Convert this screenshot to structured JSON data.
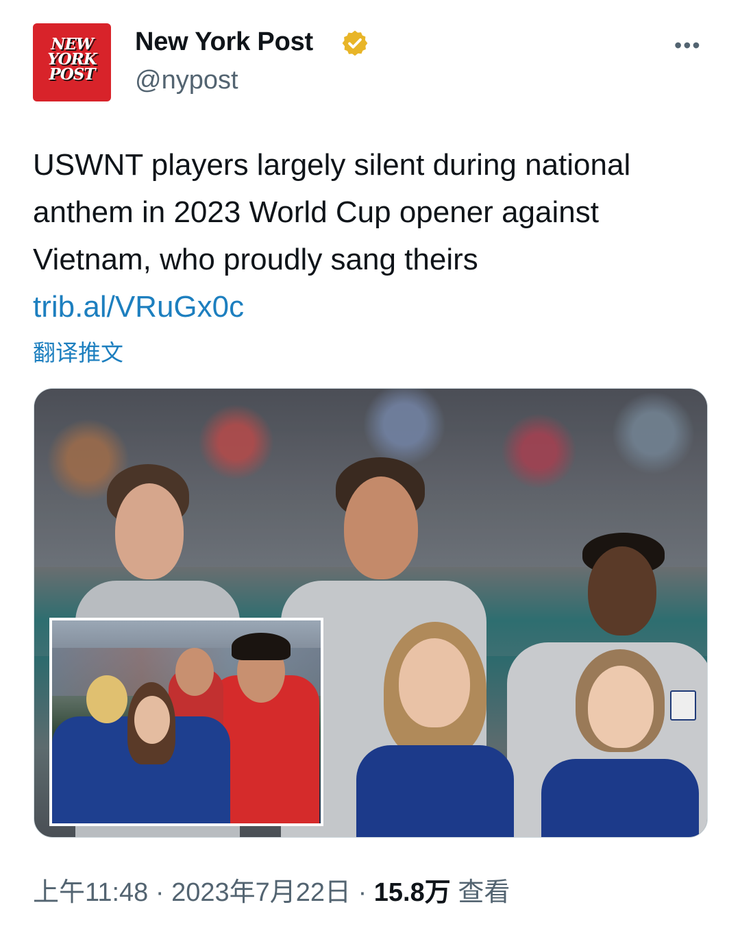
{
  "author": {
    "logo_text": "NEW YORK POST",
    "display_name": "New York Post",
    "handle": "@nypost",
    "verified": true,
    "avatar_color": "#d8232a"
  },
  "menu_icon": "more-horizontal-icon",
  "tweet": {
    "text": "USWNT players largely silent during national anthem in 2023 World Cup opener against Vietnam, who proudly sang theirs",
    "link": "trib.al/VRuGx0c",
    "translate_label": "翻译推文"
  },
  "photo": {
    "inset_present": true
  },
  "meta": {
    "time": "上午11:48",
    "separator": "·",
    "date": "2023年7月22日",
    "views_count": "15.8万",
    "views_label": "查看"
  },
  "colors": {
    "link": "#1d7fbf",
    "secondary_text": "#536471",
    "verified_badge": "#e8b528"
  }
}
